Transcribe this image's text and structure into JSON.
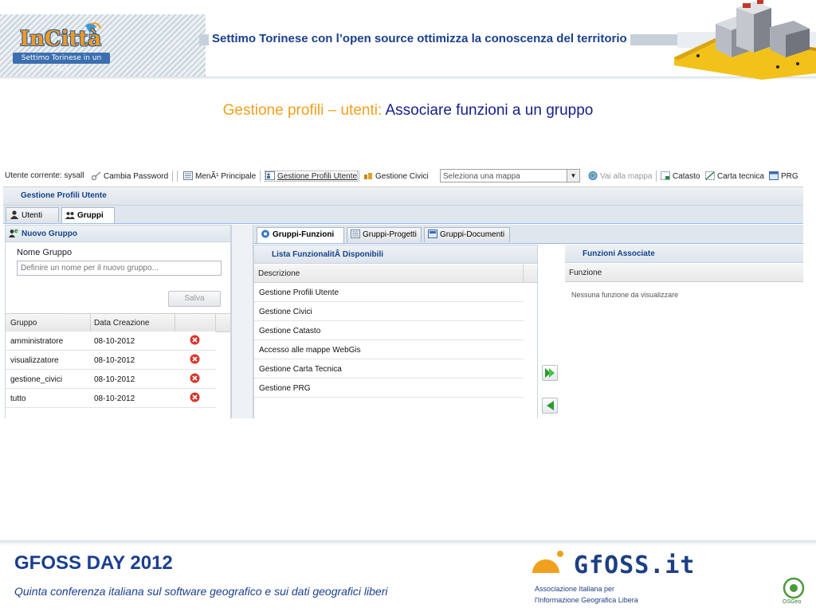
{
  "header": {
    "title": "Settimo Torinese con l’open source ottimizza la conoscenza del territorio",
    "logo_text": "InCittà",
    "logo_subtitle": "Settimo Torinese in un click"
  },
  "slide": {
    "title_part1": "Gestione profili – utenti: ",
    "title_part2": "Associare funzioni a un gruppo"
  },
  "toolbar": {
    "current_user": "Utente corrente: sysall",
    "change_password": "Cambia Password",
    "main_menu": "MenÃ¹ Principale",
    "profile_management": "Gestione Profili Utente",
    "civic_management": "Gestione Civici",
    "map_select_placeholder": "Seleziona una mappa",
    "go_to_map": "Vai alla mappa",
    "catasto": "Catasto",
    "carta_tecnica": "Carta tecnica",
    "prg": "PRG"
  },
  "panel": {
    "title": "Gestione Profili Utente",
    "tabs": [
      {
        "label": "Utenti"
      },
      {
        "label": "Gruppi"
      }
    ]
  },
  "new_group": {
    "header": "Nuovo Gruppo",
    "name_label": "Nome Gruppo",
    "name_placeholder": "Definire un nome per il nuovo gruppo...",
    "save_button": "Salva"
  },
  "groups_grid": {
    "columns": [
      "Gruppo",
      "Data Creazione"
    ],
    "rows": [
      {
        "name": "amministratore",
        "date": "08-10-2012"
      },
      {
        "name": "visualizzatore",
        "date": "08-10-2012"
      },
      {
        "name": "gestione_civici",
        "date": "08-10-2012"
      },
      {
        "name": "tutto",
        "date": "08-10-2012"
      }
    ]
  },
  "sub_tabs": [
    {
      "label": "Gruppi-Funzioni"
    },
    {
      "label": "Gruppi-Progetti"
    },
    {
      "label": "Gruppi-Documenti"
    }
  ],
  "available": {
    "header": "Lista FunzionalitÃ  Disponibili",
    "column": "Descrizione",
    "rows": [
      "Gestione Profili Utente",
      "Gestione Civici",
      "Gestione Catasto",
      "Accesso alle mappe WebGis",
      "Gestione Carta Tecnica",
      "Gestione PRG"
    ]
  },
  "associated": {
    "header": "Funzioni Associate",
    "column": "Funzione",
    "empty_message": "Nessuna funzione da visualizzare"
  },
  "footer": {
    "title": "GFOSS DAY 2012",
    "subtitle": "Quinta conferenza italiana sul software geografico e sui dati geografici liberi",
    "org_logo": "GfOSS.it",
    "org_line1": "Associazione Italiana per",
    "org_line2": "l'Informazione Geografica Libera",
    "osgeo": "OSGeo"
  },
  "colors": {
    "title_orange": "#f0a01c",
    "title_blue": "#17208c",
    "header_blue": "#1a3f8f",
    "ext_header": "#15428b"
  }
}
